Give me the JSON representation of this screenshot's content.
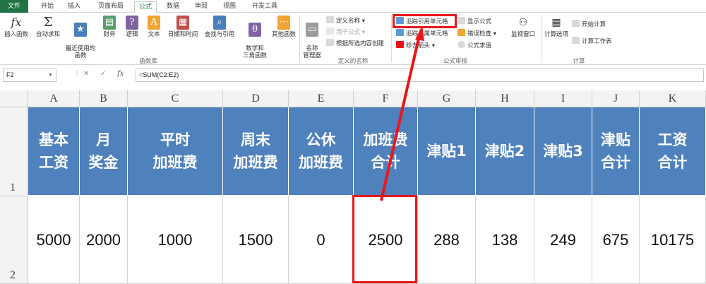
{
  "tabs": [
    {
      "label": "文件"
    },
    {
      "label": "开始"
    },
    {
      "label": "插入"
    },
    {
      "label": "页面布局"
    },
    {
      "label": "公式"
    },
    {
      "label": "数据"
    },
    {
      "label": "审阅"
    },
    {
      "label": "视图"
    },
    {
      "label": "开发工具"
    }
  ],
  "ribbon": {
    "insert_function": "插入函数",
    "autosum": "自动求和",
    "recent": "最近使用的\n函数",
    "financial": "财务",
    "logical": "逻辑",
    "text": "文本",
    "datetime": "日期和时间",
    "lookup": "查找与引用",
    "math": "数学和\n三角函数",
    "more": "其他函数",
    "group_library": "函数库",
    "name_manager": "名称\n管理器",
    "define_name": "定义名称",
    "use_in_formula": "用于公式",
    "create_from_selection": "根据所选内容创建",
    "group_names": "定义的名称",
    "trace_precedents": "追踪引用单元格",
    "trace_dependents": "追踪从属单元格",
    "remove_arrows": "移去箭头",
    "show_formulas": "显示公式",
    "error_checking": "错误检查",
    "evaluate_formula": "公式求值",
    "group_auditing": "公式审核",
    "watch_window": "监视窗口",
    "calc_options": "计算选项",
    "calc_now": "开始计算",
    "calc_sheet": "计算工作表",
    "group_calc": "计算"
  },
  "formula_bar": {
    "name_box": "F2",
    "fx": "fx",
    "formula": "=SUM(C2:E2)"
  },
  "columns": [
    "A",
    "B",
    "C",
    "D",
    "E",
    "F",
    "G",
    "H",
    "I",
    "J",
    "K"
  ],
  "rows": [
    "1",
    "2"
  ],
  "headers": [
    "基本\n工资",
    "月\n奖金",
    "平时\n加班费",
    "周末\n加班费",
    "公休\n加班费",
    "加班费\n合计",
    "津贴1",
    "津贴2",
    "津贴3",
    "津贴\n合计",
    "工资\n合计"
  ],
  "values": [
    "5000",
    "2000",
    "1000",
    "1500",
    "0",
    "2500",
    "288",
    "138",
    "249",
    "675",
    "10175"
  ],
  "colors": {
    "header_fill": "#4f81bd",
    "accent": "#217346",
    "annotation": "#e8161b"
  }
}
